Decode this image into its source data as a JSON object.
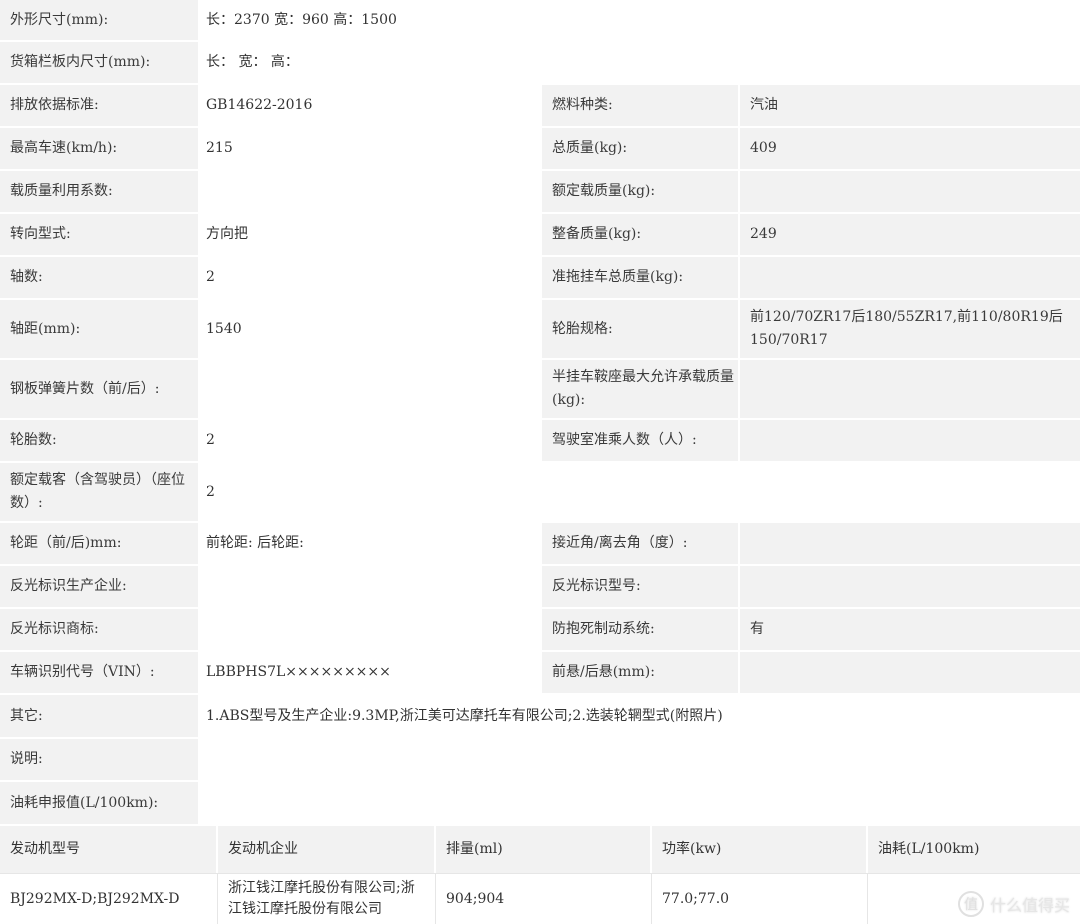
{
  "spec_rows": [
    {
      "label": "外形尺寸(mm):",
      "value": "长：2370 宽：960 高：1500"
    },
    {
      "label": "货箱栏板内尺寸(mm):",
      "value": "长：  宽：  高："
    },
    {
      "label": "排放依据标准:",
      "value": "GB14622-2016",
      "label2": "燃料种类:",
      "value2": "汽油"
    },
    {
      "label": "最高车速(km/h):",
      "value": "215",
      "label2": "总质量(kg):",
      "value2": "409"
    },
    {
      "label": "载质量利用系数:",
      "value": "",
      "label2": "额定载质量(kg):",
      "value2": ""
    },
    {
      "label": "转向型式:",
      "value": "方向把",
      "label2": "整备质量(kg):",
      "value2": "249"
    },
    {
      "label": "轴数:",
      "value": "2",
      "label2": "准拖挂车总质量(kg):",
      "value2": ""
    },
    {
      "label": "轴距(mm):",
      "value": "1540",
      "label2": "轮胎规格:",
      "value2": "前120/70ZR17后180/55ZR17,前110/80R19后150/70R17"
    },
    {
      "label": "钢板弹簧片数（前/后）:",
      "value": "",
      "label2": "半挂车鞍座最大允许承载质量(kg):",
      "value2": ""
    },
    {
      "label": "轮胎数:",
      "value": "2",
      "label2": "驾驶室准乘人数（人）:",
      "value2": ""
    },
    {
      "label": "额定载客（含驾驶员）（座位数）:",
      "value": "2"
    },
    {
      "label": "轮距（前/后)mm:",
      "value": "前轮距: 后轮距:",
      "label2": "接近角/离去角（度）:",
      "value2": ""
    },
    {
      "label": "反光标识生产企业:",
      "value": "",
      "label2": "反光标识型号:",
      "value2": ""
    },
    {
      "label": "反光标识商标:",
      "value": "",
      "label2": "防抱死制动系统:",
      "value2": "有"
    },
    {
      "label": "车辆识别代号（VIN）:",
      "value": "LBBPHS7L×××××××××",
      "label2": "前悬/后悬(mm):",
      "value2": ""
    },
    {
      "label": "其它:",
      "value": "1.ABS型号及生产企业:9.3MP,浙江美可达摩托车有限公司;2.选装轮辋型式(附照片)"
    },
    {
      "label": "说明:",
      "value": ""
    },
    {
      "label": "油耗申报值(L/100km):",
      "value": ""
    }
  ],
  "engine_table": {
    "headers": [
      "发动机型号",
      "发动机企业",
      "排量(ml)",
      "功率(kw)",
      "油耗(L/100km)"
    ],
    "rows": [
      [
        "BJ292MX-D;BJ292MX-D",
        "浙江钱江摩托股份有限公司;浙江钱江摩托股份有限公司",
        "904;904",
        "77.0;77.0",
        ""
      ]
    ]
  },
  "watermark": {
    "text": "什么值得买",
    "icon": "smzdm-logo-icon"
  },
  "colors": {
    "label_bg": "#f2f2f2",
    "value_bg": "#ffffff",
    "text": "#333333"
  }
}
